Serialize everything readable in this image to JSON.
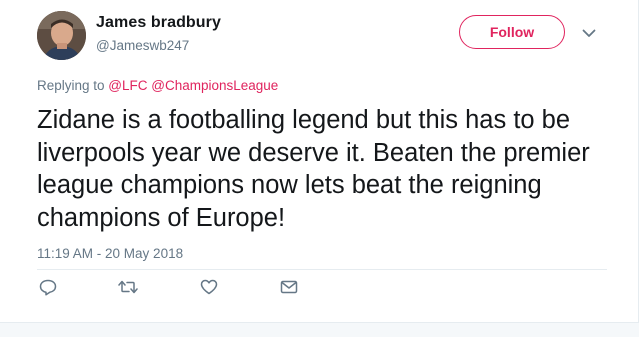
{
  "tweet": {
    "author_name": "James bradbury",
    "author_handle": "@Jameswb247",
    "follow_label": "Follow",
    "replying_prefix": "Replying to ",
    "mentions": [
      "@LFC",
      "@ChampionsLeague"
    ],
    "text": "Zidane is a footballing legend but this has to be liverpools year we deserve it. Beaten the premier league champions now lets beat the reigning champions of Europe!",
    "timestamp": "11:19 AM - 20 May 2018"
  },
  "icons": {
    "reply": "reply-icon",
    "retweet": "retweet-icon",
    "like": "heart-icon",
    "message": "envelope-icon",
    "caret": "chevron-down-icon"
  },
  "colors": {
    "accent": "#e0245e",
    "secondary_text": "#657786",
    "primary_text": "#14171a"
  }
}
